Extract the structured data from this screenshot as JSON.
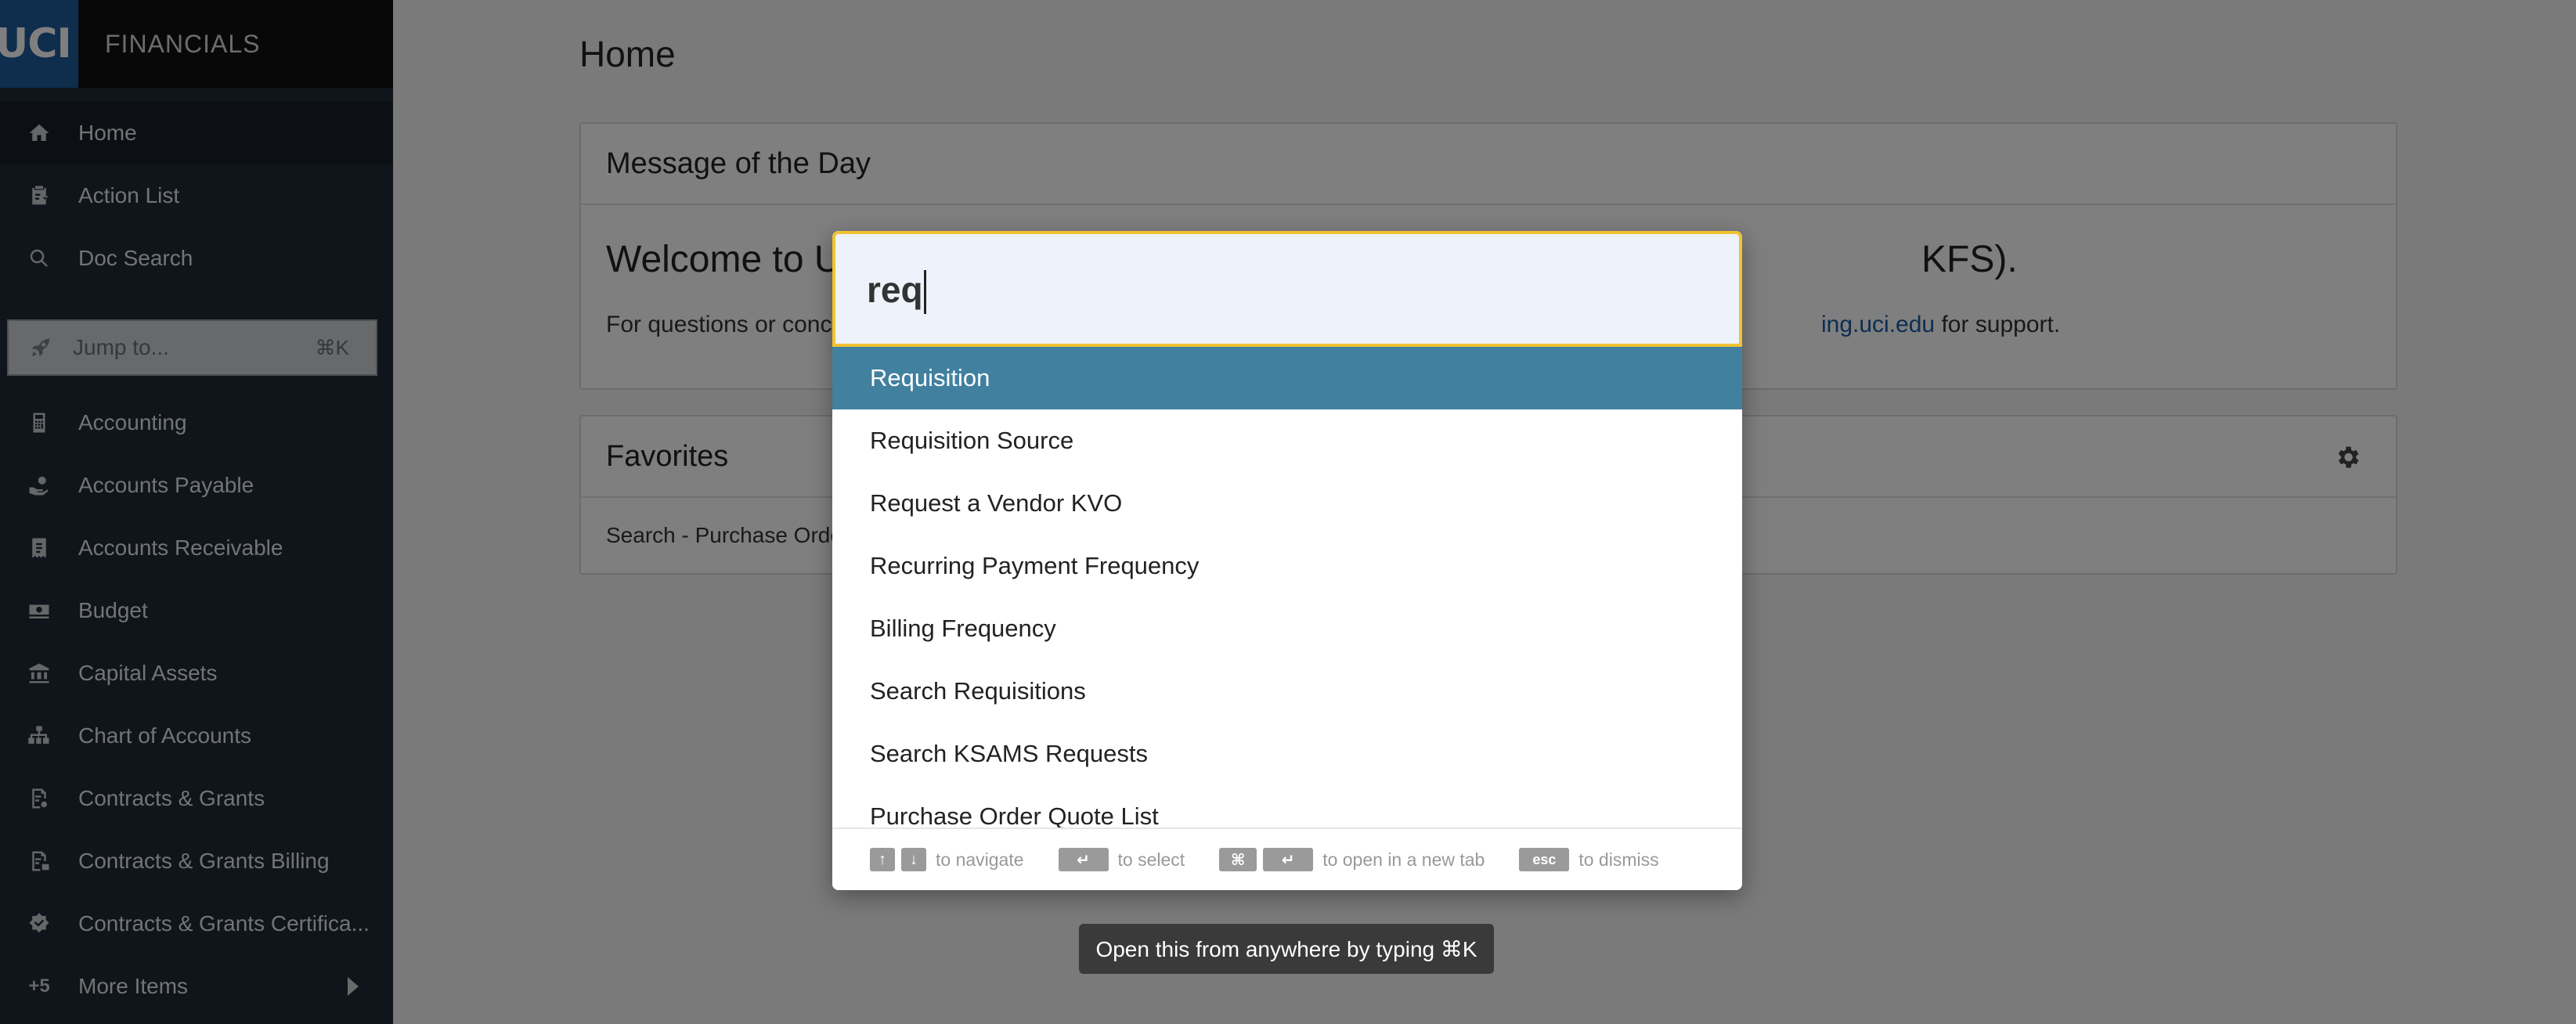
{
  "brand": {
    "logo_text": "UCI",
    "app_name": "FINANCIALS"
  },
  "sidebar": {
    "items": [
      {
        "label": "Home",
        "icon": "home-icon"
      },
      {
        "label": "Action List",
        "icon": "clipboard-icon"
      },
      {
        "label": "Doc Search",
        "icon": "search-icon"
      },
      {
        "label": "Accounting",
        "icon": "calculator-icon"
      },
      {
        "label": "Accounts Payable",
        "icon": "hand-money-icon"
      },
      {
        "label": "Accounts Receivable",
        "icon": "receipt-icon"
      },
      {
        "label": "Budget",
        "icon": "money-stack-icon"
      },
      {
        "label": "Capital Assets",
        "icon": "bank-icon"
      },
      {
        "label": "Chart of Accounts",
        "icon": "sitemap-icon"
      },
      {
        "label": "Contracts & Grants",
        "icon": "contract-icon"
      },
      {
        "label": "Contracts & Grants Billing",
        "icon": "contract-billing-icon"
      },
      {
        "label": "Contracts & Grants Certifica...",
        "icon": "badge-check-icon"
      },
      {
        "label": "More Items",
        "count": "+5"
      }
    ],
    "jump": {
      "label": "Jump to...",
      "shortcut": "⌘K"
    }
  },
  "main": {
    "title": "Home",
    "motd": {
      "title": "Message of the Day",
      "welcome_start": "Welcome to U",
      "welcome_end": "KFS).",
      "support_start": "For questions or conc",
      "support_link": "ing.uci.edu",
      "support_end": " for support."
    },
    "favorites": {
      "title": "Favorites",
      "item": "Search - Purchase Orde"
    }
  },
  "palette": {
    "query": "req",
    "results": [
      "Requisition",
      "Requisition Source",
      "Request a Vendor KVO",
      "Recurring Payment Frequency",
      "Billing Frequency",
      "Search Requisitions",
      "Search KSAMS Requests",
      "Purchase Order Quote List"
    ],
    "footer": {
      "up_key": "↑",
      "down_key": "↓",
      "navigate": "to navigate",
      "enter_key": "↵",
      "select": "to select",
      "cmd_key": "⌘",
      "new_tab": "to open in a new tab",
      "esc_key": "esc",
      "dismiss": "to dismiss"
    }
  },
  "tooltip": "Open this from anywhere by typing ⌘K"
}
